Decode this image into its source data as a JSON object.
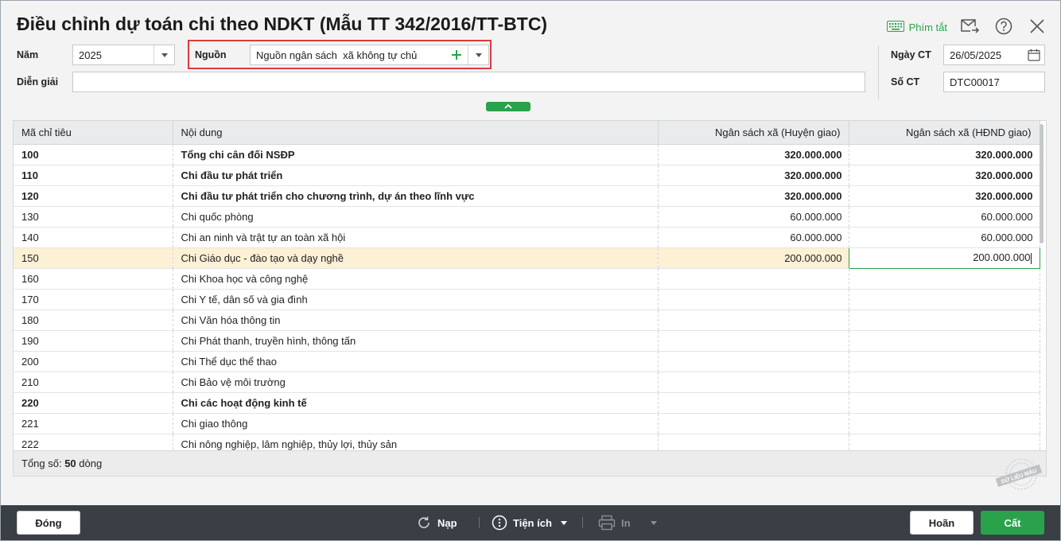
{
  "window": {
    "title": "Điều chỉnh dự toán chi theo NDKT (Mẫu TT 342/2016/TT-BTC)",
    "shortcut_label": "Phím tắt"
  },
  "form": {
    "year_label": "Năm",
    "year_value": "2025",
    "source_label": "Nguồn",
    "source_value": "Nguồn ngân sách  xã không tự chủ",
    "description_label": "Diễn giải",
    "description_value": "",
    "date_label": "Ngày CT",
    "date_value": "26/05/2025",
    "docno_label": "Số CT",
    "docno_value": "DTC00017"
  },
  "grid": {
    "columns": [
      "Mã chỉ tiêu",
      "Nội dung",
      "Ngân sách xã (Huyện giao)",
      "Ngân sách xã (HĐND giao)"
    ],
    "rows": [
      {
        "code": "100",
        "content": "Tổng chi cân đối NSĐP",
        "district": "320.000.000",
        "council": "320.000.000",
        "bold": true
      },
      {
        "code": "110",
        "content": "Chi đầu tư phát triển",
        "district": "320.000.000",
        "council": "320.000.000",
        "bold": true
      },
      {
        "code": "120",
        "content": "Chi đầu tư phát triển cho chương trình, dự án theo lĩnh vực",
        "district": "320.000.000",
        "council": "320.000.000",
        "bold": true
      },
      {
        "code": "130",
        "content": "Chi quốc phòng",
        "district": "60.000.000",
        "council": "60.000.000",
        "bold": false
      },
      {
        "code": "140",
        "content": "Chi an ninh và trật tự an toàn xã hội",
        "district": "60.000.000",
        "council": "60.000.000",
        "bold": false
      },
      {
        "code": "150",
        "content": "Chi Giáo dục - đào tạo và dạy nghề",
        "district": "200.000.000",
        "council": "200.000.000",
        "bold": false,
        "selected": true
      },
      {
        "code": "160",
        "content": "Chi Khoa học và công nghệ",
        "district": "",
        "council": "",
        "bold": false
      },
      {
        "code": "170",
        "content": "Chi Y tế, dân số và gia đình",
        "district": "",
        "council": "",
        "bold": false
      },
      {
        "code": "180",
        "content": "Chi Văn hóa thông tin",
        "district": "",
        "council": "",
        "bold": false
      },
      {
        "code": "190",
        "content": "Chi Phát thanh, truyền hình, thông tấn",
        "district": "",
        "council": "",
        "bold": false
      },
      {
        "code": "200",
        "content": "Chi Thể dục thể thao",
        "district": "",
        "council": "",
        "bold": false
      },
      {
        "code": "210",
        "content": "Chi Bảo vệ môi trường",
        "district": "",
        "council": "",
        "bold": false
      },
      {
        "code": "220",
        "content": "Chi các hoạt động kinh tế",
        "district": "",
        "council": "",
        "bold": true
      },
      {
        "code": "221",
        "content": "Chi giao thông",
        "district": "",
        "council": "",
        "bold": false
      },
      {
        "code": "222",
        "content": "Chi nông nghiệp, lâm nghiệp, thủy lợi, thủy sản",
        "district": "",
        "council": "",
        "bold": false
      }
    ],
    "total_prefix": "Tổng số: ",
    "total_count": "50",
    "total_suffix": " dòng"
  },
  "toolbar": {
    "close_label": "Đóng",
    "reload_label": "Nạp",
    "utilities_label": "Tiện ích",
    "print_label": "In",
    "cancel_label": "Hoãn",
    "save_label": "Cất"
  },
  "watermark_text": "DỮ LIỆU MẪU",
  "colors": {
    "accent": "#2aa24b",
    "selected_row": "#fcf0d5",
    "highlight_border": "#e0383e",
    "bottom_bar": "#3a3f45"
  }
}
